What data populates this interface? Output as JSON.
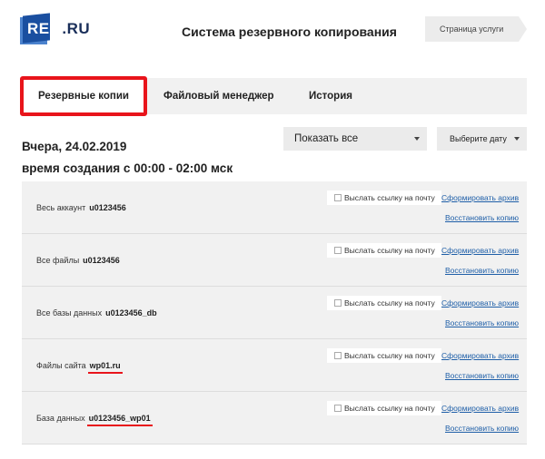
{
  "header": {
    "logo_text_main": "REG",
    "logo_text_suffix": ".RU",
    "title": "Система резервного копирования",
    "service_page_label": "Страница услуги"
  },
  "tabs": [
    {
      "label": "Резервные копии",
      "active": true
    },
    {
      "label": "Файловый менеджер",
      "active": false
    },
    {
      "label": "История",
      "active": false
    }
  ],
  "backup_info": {
    "date_line": "Вчера, 24.02.2019",
    "time_line": "время создания с 00:00 - 02:00 мск"
  },
  "filters": {
    "show_select_value": "Показать все",
    "date_select_value": "Выберите дату"
  },
  "rows": [
    {
      "label": "Весь аккаунт",
      "value": "u0123456",
      "email_label": "Выслать ссылку на почту",
      "archive_link": "Сформировать архив",
      "restore_link": "Восстановить копию",
      "underlined": false
    },
    {
      "label": "Все файлы",
      "value": "u0123456",
      "email_label": "Выслать ссылку на почту",
      "archive_link": "Сформировать архив",
      "restore_link": "Восстановить копию",
      "underlined": false
    },
    {
      "label": "Все базы данных",
      "value": "u0123456_db",
      "email_label": "Выслать ссылку на почту",
      "archive_link": "Сформировать архив",
      "restore_link": "Восстановить копию",
      "underlined": false
    },
    {
      "label": "Файлы сайта",
      "value": "wp01.ru",
      "email_label": "Выслать ссылку на почту",
      "archive_link": "Сформировать архив",
      "restore_link": "Восстановить копию",
      "underlined": true
    },
    {
      "label": "База данных",
      "value": "u0123456_wp01",
      "email_label": "Выслать ссылку на почту",
      "archive_link": "Сформировать архив",
      "restore_link": "Восстановить копию",
      "underlined": true
    }
  ],
  "colors": {
    "highlight": "#e8141b",
    "link": "#1f5fa8",
    "row_bg": "#f1f1f1",
    "brand": "#1a4fa0"
  }
}
